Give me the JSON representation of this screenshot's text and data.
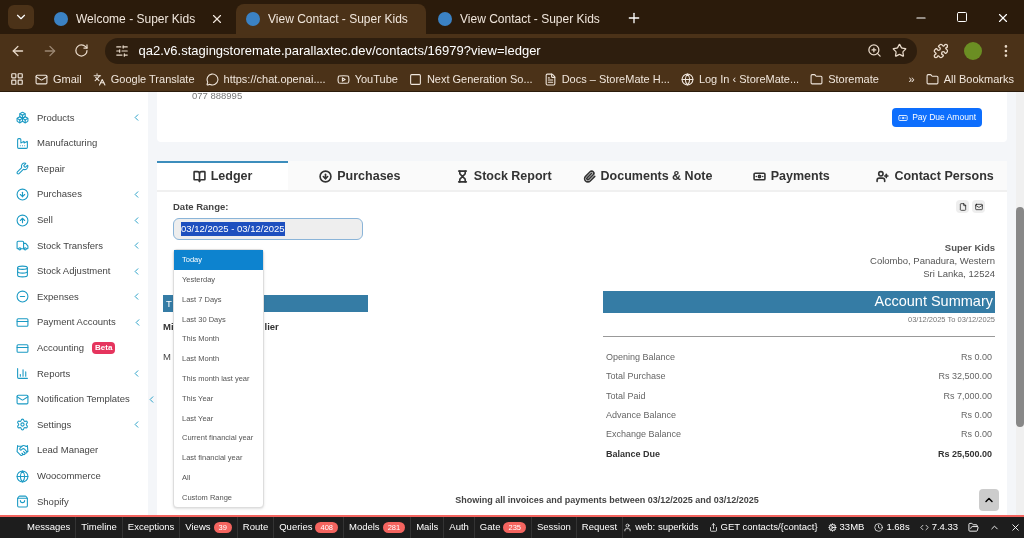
{
  "browser": {
    "tabs": [
      {
        "title": "Welcome - Super Kids",
        "selected": false
      },
      {
        "title": "View Contact - Super Kids",
        "selected": true
      },
      {
        "title": "View Contact - Super Kids",
        "selected": false
      }
    ],
    "url": "qa2.v6.stagingstoremate.parallaxtec.dev/contacts/16979?view=ledger",
    "bookmarks": [
      {
        "label": "Gmail",
        "kind": "mail"
      },
      {
        "label": "Google Translate",
        "kind": "translate"
      },
      {
        "label": "https://chat.openai....",
        "kind": "chat"
      },
      {
        "label": "YouTube",
        "kind": "video"
      },
      {
        "label": "Next Generation So...",
        "kind": "dark"
      },
      {
        "label": "Docs – StoreMate H...",
        "kind": "docs"
      },
      {
        "label": "Log In ‹ StoreMate...",
        "kind": "wp"
      },
      {
        "label": "Storemate",
        "kind": "folder"
      }
    ],
    "more": "»",
    "all_bookmarks": "All Bookmarks"
  },
  "sidebar": {
    "items": [
      {
        "label": "Products",
        "kind": "products",
        "expandable": true
      },
      {
        "label": "Manufacturing",
        "kind": "factory",
        "expandable": false
      },
      {
        "label": "Repair",
        "kind": "wrench",
        "expandable": false
      },
      {
        "label": "Purchases",
        "kind": "down",
        "expandable": true
      },
      {
        "label": "Sell",
        "kind": "up",
        "expandable": true
      },
      {
        "label": "Stock Transfers",
        "kind": "truck",
        "expandable": true
      },
      {
        "label": "Stock Adjustment",
        "kind": "database",
        "expandable": true
      },
      {
        "label": "Expenses",
        "kind": "minus",
        "expandable": true
      },
      {
        "label": "Payment Accounts",
        "kind": "card",
        "expandable": true
      },
      {
        "label": "Accounting",
        "kind": "card",
        "expandable": false,
        "badge": "Beta"
      },
      {
        "label": "Reports",
        "kind": "chart",
        "expandable": true
      },
      {
        "label": "Notification Templates",
        "kind": "mail",
        "expandable": true
      },
      {
        "label": "Settings",
        "kind": "gear",
        "expandable": true
      },
      {
        "label": "Lead Manager",
        "kind": "hands",
        "expandable": false
      },
      {
        "label": "Woocommerce",
        "kind": "wp",
        "expandable": false
      },
      {
        "label": "Shopify",
        "kind": "bag",
        "expandable": false
      }
    ]
  },
  "contact": {
    "phone": "077 888995",
    "pay_button": "Pay Due Amount"
  },
  "tabs": [
    {
      "label": "Ledger",
      "kind": "ledger",
      "selected": true
    },
    {
      "label": "Purchases",
      "kind": "down",
      "selected": false
    },
    {
      "label": "Stock Report",
      "kind": "hourglass",
      "selected": false
    },
    {
      "label": "Documents & Note",
      "kind": "clip",
      "selected": false
    },
    {
      "label": "Payments",
      "kind": "money",
      "selected": false
    },
    {
      "label": "Contact Persons",
      "kind": "userplus",
      "selected": false
    }
  ],
  "date_range": {
    "label": "Date Range:",
    "value": "03/12/2025 - 03/12/2025",
    "options": [
      {
        "label": "Today",
        "selected": true
      },
      {
        "label": "Yesterday",
        "selected": false
      },
      {
        "label": "Last 7 Days",
        "selected": false
      },
      {
        "label": "Last 30 Days",
        "selected": false
      },
      {
        "label": "This Month",
        "selected": false
      },
      {
        "label": "Last Month",
        "selected": false
      },
      {
        "label": "This month last year",
        "selected": false
      },
      {
        "label": "This Year",
        "selected": false
      },
      {
        "label": "Last Year",
        "selected": false
      },
      {
        "label": "Current financial year",
        "selected": false
      },
      {
        "label": "Last financial year",
        "selected": false
      },
      {
        "label": "All",
        "selected": false
      },
      {
        "label": "Custom Range",
        "selected": false
      }
    ]
  },
  "ledger_left": {
    "bar_text": "T",
    "line_start": "Mi",
    "line_end": "lier",
    "line_2": "M"
  },
  "business": {
    "name": "Super Kids",
    "address_1": "Colombo, Panadura, Western",
    "address_2": "Sri Lanka, 12524"
  },
  "summary": {
    "title": "Account Summary",
    "period": "03/12/2025 To 03/12/2025",
    "rows": [
      {
        "label": "Opening Balance",
        "value": "Rs 0.00",
        "bold": false
      },
      {
        "label": "Total Purchase",
        "value": "Rs 32,500.00",
        "bold": false
      },
      {
        "label": "Total Paid",
        "value": "Rs 7,000.00",
        "bold": false
      },
      {
        "label": "Advance Balance",
        "value": "Rs 0.00",
        "bold": false
      },
      {
        "label": "Exchange Balance",
        "value": "Rs 0.00",
        "bold": false
      },
      {
        "label": "Balance Due",
        "value": "Rs 25,500.00",
        "bold": true
      }
    ]
  },
  "note": "Showing all invoices and payments between 03/12/2025 and 03/12/2025",
  "debugbar": {
    "items": [
      {
        "label": "Messages"
      },
      {
        "label": "Timeline"
      },
      {
        "label": "Exceptions"
      },
      {
        "label": "Views",
        "count": "39"
      },
      {
        "label": "Route"
      },
      {
        "label": "Queries",
        "count": "408"
      },
      {
        "label": "Models",
        "count": "281"
      },
      {
        "label": "Mails"
      },
      {
        "label": "Auth"
      },
      {
        "label": "Gate",
        "count": "235"
      },
      {
        "label": "Session"
      },
      {
        "label": "Request"
      }
    ],
    "user": "web: superkids",
    "route": "GET contacts/{contact}",
    "memory": "33MB",
    "time": "1.68s",
    "php": "7.4.33"
  }
}
